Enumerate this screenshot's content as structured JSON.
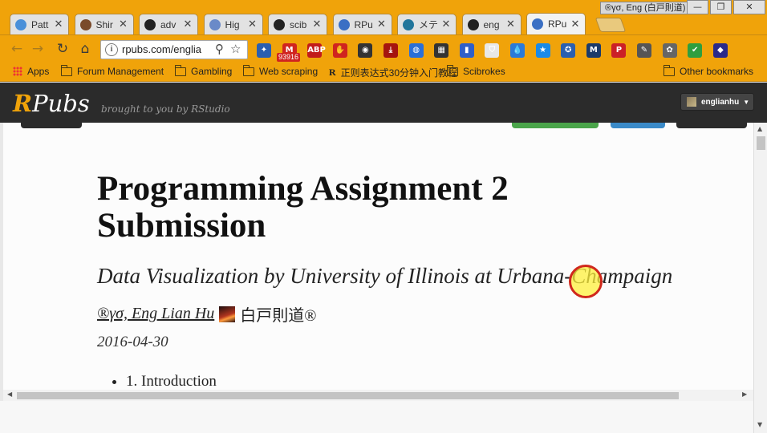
{
  "browser": {
    "tabs": [
      {
        "label": "Patt",
        "icon": "infinity-icon",
        "color": "#4a90d9",
        "active": false
      },
      {
        "label": "Shir",
        "icon": "avatar-photo-icon",
        "color": "#7a4a2a",
        "active": false
      },
      {
        "label": "adv",
        "icon": "github-icon",
        "color": "#222222",
        "active": false
      },
      {
        "label": "Hig",
        "icon": "chart-icon",
        "color": "#6a8ac8",
        "active": false
      },
      {
        "label": "scib",
        "icon": "github-icon",
        "color": "#222222",
        "active": false
      },
      {
        "label": "RPu",
        "icon": "rpubs-icon",
        "color": "#3a6fc4",
        "active": false
      },
      {
        "label": "メテ",
        "icon": "wordpress-icon",
        "color": "#21759b",
        "active": false
      },
      {
        "label": "eng",
        "icon": "github-icon",
        "color": "#222222",
        "active": false
      },
      {
        "label": "RPu",
        "icon": "rpubs-icon",
        "color": "#3a6fc4",
        "active": true
      }
    ],
    "tab_close_glyph": "✕",
    "user_badge": "®γσ, Eng (白戸則道)",
    "window_controls": {
      "minimize": "—",
      "restore": "❐",
      "close": "✕"
    },
    "url": "rpubs.com/englia",
    "extension_badge": "93916",
    "extensions": [
      {
        "name": "flag-icon",
        "glyph": "✦",
        "color": "#2a5fb0"
      },
      {
        "name": "gmail-icon",
        "glyph": "M",
        "color": "#d0241f"
      },
      {
        "name": "adblock-icon",
        "glyph": "ABP",
        "color": "#c21b1b"
      },
      {
        "name": "stop-hand-icon",
        "glyph": "✋",
        "color": "#d0241f"
      },
      {
        "name": "owl-icon",
        "glyph": "◉",
        "color": "#333333"
      },
      {
        "name": "pdf-icon",
        "glyph": "⤓",
        "color": "#a5140f"
      },
      {
        "name": "chrome-ext-icon",
        "glyph": "◍",
        "color": "#2a6fd8"
      },
      {
        "name": "film-icon",
        "glyph": "▦",
        "color": "#333333"
      },
      {
        "name": "stats-icon",
        "glyph": "▮",
        "color": "#2f5fc8"
      },
      {
        "name": "shield-icon",
        "glyph": "⛉",
        "color": "#e8e8e8"
      },
      {
        "name": "drop-icon",
        "glyph": "💧",
        "color": "#2a7ad8"
      },
      {
        "name": "star-ext-icon",
        "glyph": "★",
        "color": "#1a8ae8"
      },
      {
        "name": "badge-ext-icon",
        "glyph": "✪",
        "color": "#2a5fb0"
      },
      {
        "name": "mendeley-icon",
        "glyph": "M",
        "color": "#1a3a6a"
      },
      {
        "name": "pinterest-icon",
        "glyph": "P",
        "color": "#cb2027"
      },
      {
        "name": "tool-icon",
        "glyph": "✎",
        "color": "#555555"
      },
      {
        "name": "gear-ext-icon",
        "glyph": "✿",
        "color": "#666666"
      },
      {
        "name": "green-ext-icon",
        "glyph": "✔",
        "color": "#2f9e3f"
      },
      {
        "name": "more-ext-icon",
        "glyph": "◆",
        "color": "#2a2a8a"
      }
    ],
    "bookmarks": [
      {
        "label": "Apps",
        "kind": "apps"
      },
      {
        "label": "Forum Management",
        "kind": "folder"
      },
      {
        "label": "Gambling",
        "kind": "folder"
      },
      {
        "label": "Web scraping",
        "kind": "folder"
      },
      {
        "label": "正则表达式30分钟入门教程",
        "kind": "r"
      },
      {
        "label": "Scibrokes",
        "kind": "folder"
      }
    ],
    "bookmarks_right": "Other bookmarks"
  },
  "rpubs": {
    "logo_r": "R",
    "logo_rest": "Pubs",
    "tagline": "brought to you by RStudio",
    "user": "englianhu",
    "accent": "#f0a30a"
  },
  "document": {
    "title": "Programming Assignment 2 Submission",
    "subtitle": "Data Visualization by University of Illinois at Urbana-Champaign",
    "author_link": "®γσ, Eng Lian Hu",
    "author_suffix": "白戸則道®",
    "date": "2016-04-30",
    "toc": [
      "1. Introduction"
    ]
  },
  "scroll": {
    "up": "▲",
    "down": "▼",
    "left": "◀",
    "right": "▶"
  }
}
